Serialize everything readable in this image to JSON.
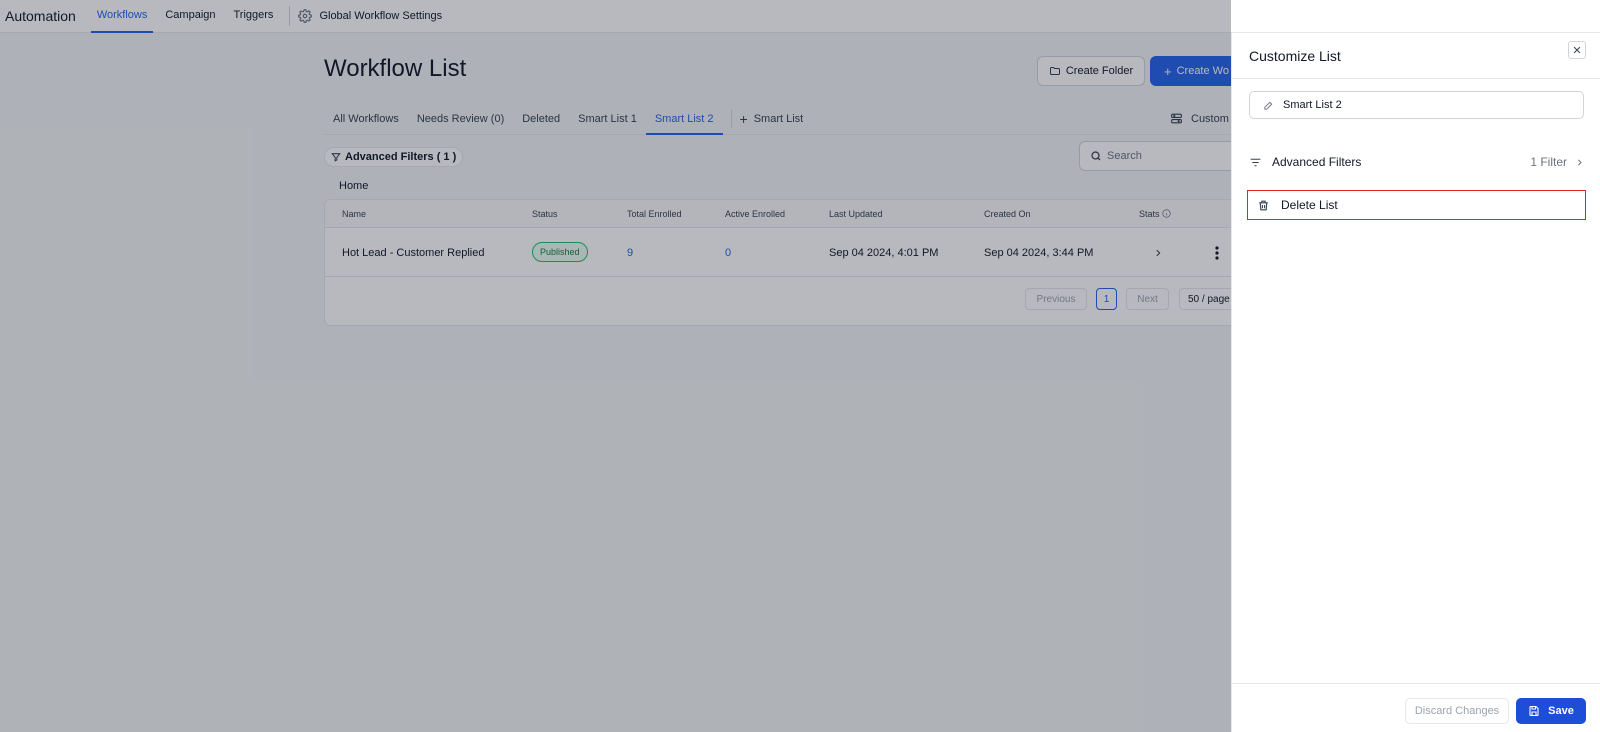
{
  "topnav": {
    "brand": "Automation",
    "tabs": [
      {
        "label": "Workflows"
      },
      {
        "label": "Campaign"
      },
      {
        "label": "Triggers"
      }
    ],
    "settings_label": "Global Workflow Settings"
  },
  "main": {
    "title": "Workflow List",
    "create_folder_label": "Create Folder",
    "create_workflow_label": "Create Wo",
    "tabs": [
      {
        "label": "All Workflows"
      },
      {
        "label": "Needs Review (0)"
      },
      {
        "label": "Deleted"
      },
      {
        "label": "Smart List 1"
      },
      {
        "label": "Smart List 2"
      }
    ],
    "add_smart_list_label": "Smart List",
    "customize_label": "Custom",
    "advanced_filters_label": "Advanced Filters ( 1 )",
    "search_placeholder": "Search",
    "breadcrumb": "Home",
    "table": {
      "columns": [
        "Name",
        "Status",
        "Total Enrolled",
        "Active Enrolled",
        "Last Updated",
        "Created On",
        "Stats"
      ],
      "rows": [
        {
          "name": "Hot Lead - Customer Replied",
          "status": "Published",
          "total_enrolled": "9",
          "active_enrolled": "0",
          "last_updated": "Sep 04 2024, 4:01 PM",
          "created_on": "Sep 04 2024, 3:44 PM"
        }
      ]
    },
    "pagination": {
      "previous_label": "Previous",
      "current_page": "1",
      "next_label": "Next",
      "page_size": "50 / page"
    }
  },
  "drawer": {
    "title": "Customize List",
    "list_name_value": "Smart List 2",
    "advanced_filters_label": "Advanced Filters",
    "filter_count": "1 Filter",
    "delete_label": "Delete List",
    "discard_label": "Discard Changes",
    "save_label": "Save"
  },
  "colors": {
    "accent": "#2563eb",
    "highlight": "#dc2626",
    "published": "#15803d"
  }
}
